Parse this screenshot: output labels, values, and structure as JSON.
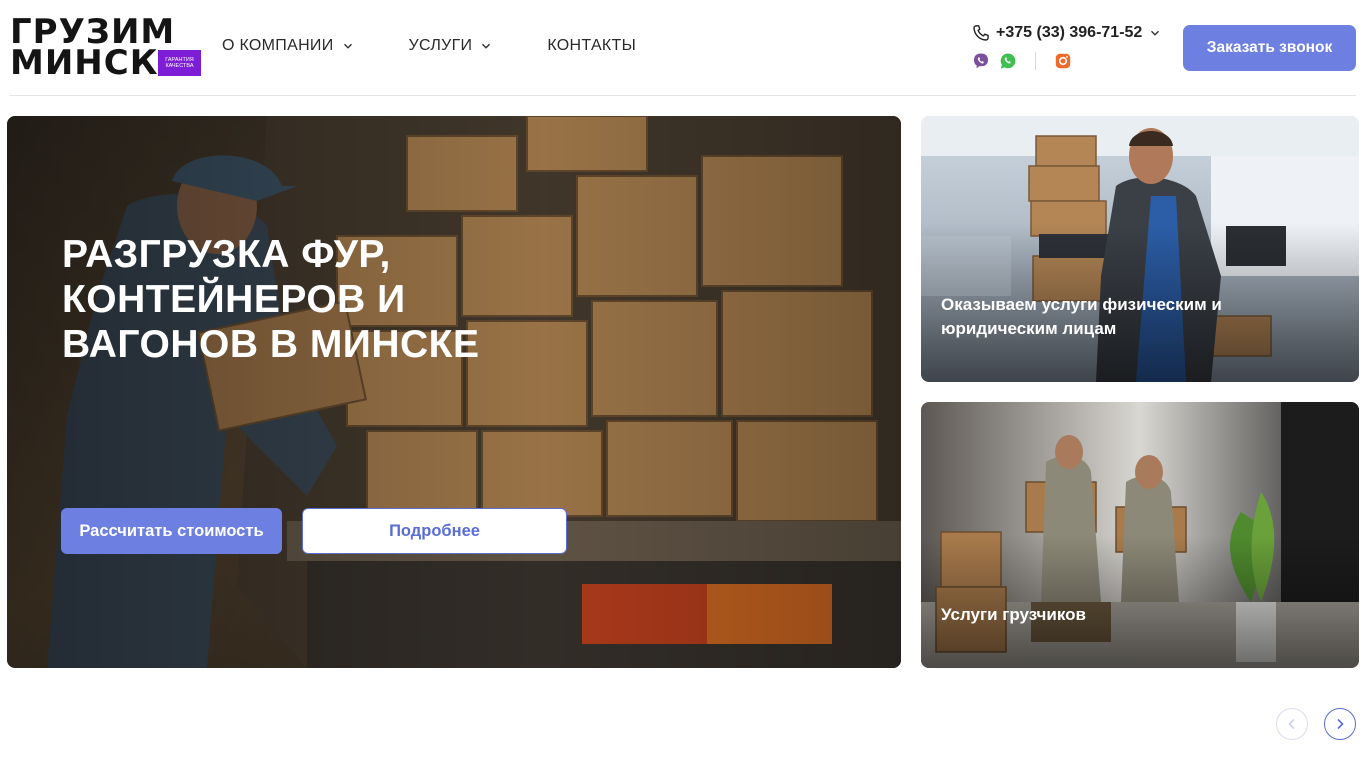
{
  "header": {
    "logo": {
      "line1": "ГРУЗИМ",
      "line2": "МИНСК",
      "badge": "Гарантия качества"
    },
    "nav": [
      {
        "label": "О КОМПАНИИ",
        "has_dropdown": true
      },
      {
        "label": "УСЛУГИ",
        "has_dropdown": true
      },
      {
        "label": "КОНТАКТЫ",
        "has_dropdown": false
      }
    ],
    "phone": "+375 (33) 396-71-52",
    "social_icons": [
      "viber-icon",
      "whatsapp-icon",
      "instagram-icon"
    ],
    "cta_label": "Заказать звонок"
  },
  "hero": {
    "title": "РАЗГРУЗКА ФУР, КОНТЕЙНЕРОВ И ВАГОНОВ В МИНСКЕ",
    "primary_button": "Рассчитать стоимость",
    "secondary_button": "Подробнее"
  },
  "cards": [
    {
      "label": "Оказываем услуги физическим и юридическим лицам"
    },
    {
      "label": "Услуги грузчиков"
    }
  ],
  "slider": {
    "prev_icon": "chevron-left-icon",
    "next_icon": "chevron-right-icon"
  },
  "colors": {
    "accent": "#6d7fe0",
    "accent_dark": "#5a6cd6",
    "badge": "#7d1ed6",
    "viber": "#7b519d",
    "whatsapp": "#3fbf4f",
    "instagram": "#f06a2a"
  }
}
